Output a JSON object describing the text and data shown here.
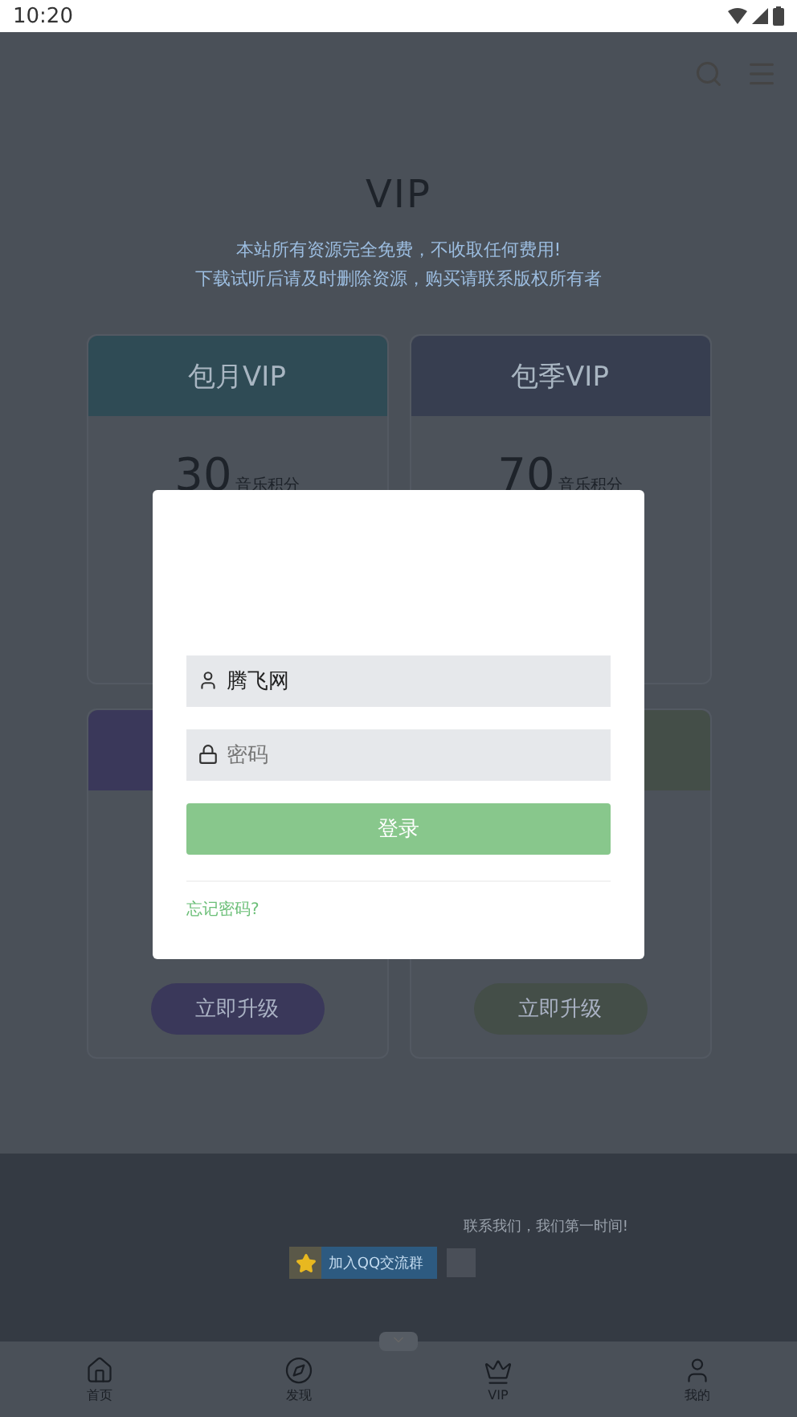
{
  "status_bar": {
    "time": "10:20"
  },
  "page": {
    "title": "VIP",
    "subtitle_lines": [
      "本站所有资源完全免费，不收取任何费用!",
      "下载试听后请及时删除资源，购买请联系版权所有者"
    ]
  },
  "plans": [
    {
      "title": "包月VIP",
      "color": "#2f4b55",
      "points": "30",
      "unit": "音乐积分"
    },
    {
      "title": "包季VIP",
      "color": "#373e50",
      "points": "70",
      "unit": "音乐积分"
    },
    {
      "color": "#3a385a",
      "button": "立即升级"
    },
    {
      "color": "#444e48",
      "button": "立即升级"
    }
  ],
  "footer": {
    "text": "联系我们，我们第一时间!",
    "badge": "加入QQ交流群"
  },
  "nav": [
    {
      "label": "首页"
    },
    {
      "label": "发现"
    },
    {
      "label": "VIP"
    },
    {
      "label": "我的"
    }
  ],
  "login": {
    "username": "腾飞网",
    "password_placeholder": "密码",
    "submit": "登录",
    "forgot": "忘记密码?"
  }
}
